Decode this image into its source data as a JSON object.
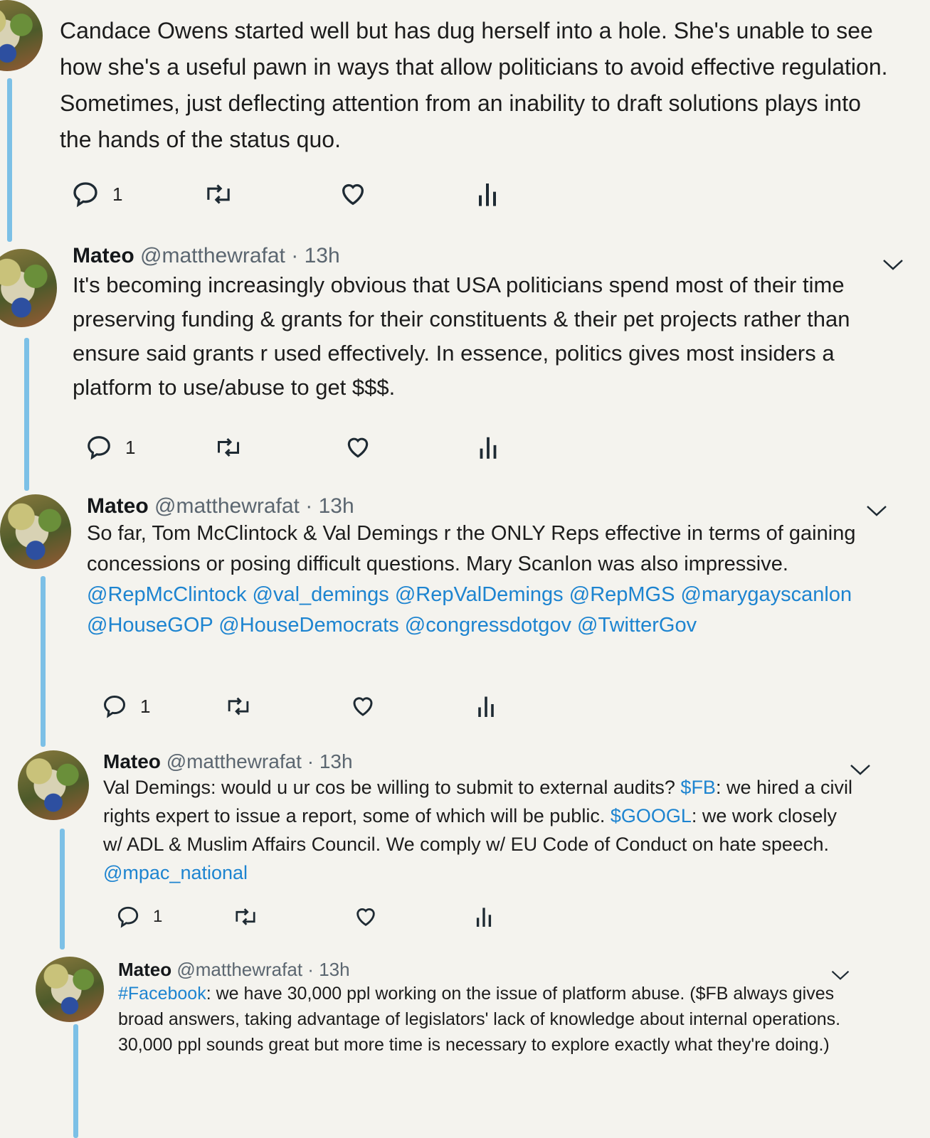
{
  "tweets": [
    {
      "name": "",
      "handle": "",
      "time": "",
      "text": "Candace Owens started well but has dug herself into a hole. She's unable to see how she's a useful pawn in ways that allow politicians to avoid effective regulation. Sometimes, just deflecting attention from an inability to draft solutions plays into the hands of the status quo.",
      "reply_count": "1"
    },
    {
      "name": "Mateo",
      "handle": "@matthewrafat",
      "dot": "·",
      "time": "13h",
      "text": "It's becoming increasingly obvious that USA politicians spend most of their time preserving funding & grants for their constituents & their pet projects rather than ensure said grants r used effectively. In essence, politics gives most insiders a platform to use/abuse to get $$$.",
      "reply_count": "1"
    },
    {
      "name": "Mateo",
      "handle": "@matthewrafat",
      "dot": "·",
      "time": "13h",
      "text": "So far, Tom McClintock & Val Demings r the ONLY Reps effective in terms of gaining concessions or posing difficult questions. Mary Scanlon was also impressive.",
      "mentions": [
        "@RepMcClintock",
        "@val_demings",
        "@RepValDemings",
        "@RepMGS",
        "@marygayscanlon",
        "@HouseGOP",
        "@HouseDemocrats",
        "@congressdotgov",
        "@TwitterGov"
      ],
      "reply_count": "1"
    },
    {
      "name": "Mateo",
      "handle": "@matthewrafat",
      "dot": "·",
      "time": "13h",
      "text_a": "Val Demings: would u ur cos be willing to submit to external audits?",
      "cashtag_fb": "$FB",
      "text_b": ": we hired a civil rights expert to issue a report, some of which will be public.",
      "cashtag_googl": "$GOOGL",
      "text_c": ": we work closely w/ ADL & Muslim Affairs Council. We comply w/ EU Code of Conduct on hate speech.",
      "mention": "@mpac_national",
      "reply_count": "1"
    },
    {
      "name": "Mateo",
      "handle": "@matthewrafat",
      "dot": "·",
      "time": "13h",
      "hashtag": "#Facebook",
      "text": ": we have 30,000 ppl working on the issue of platform abuse. ($FB always gives broad answers, taking advantage of legislators' lack of knowledge about internal operations. 30,000 ppl sounds great but more time is necessary to explore exactly what they're doing.)"
    }
  ],
  "icons": [
    "reply-icon",
    "retweet-icon",
    "like-icon",
    "analytics-icon",
    "chevron-down-icon"
  ],
  "colors": {
    "link": "#1d84d0",
    "thread_line": "#7cc0e6",
    "background": "#f4f3ee"
  }
}
